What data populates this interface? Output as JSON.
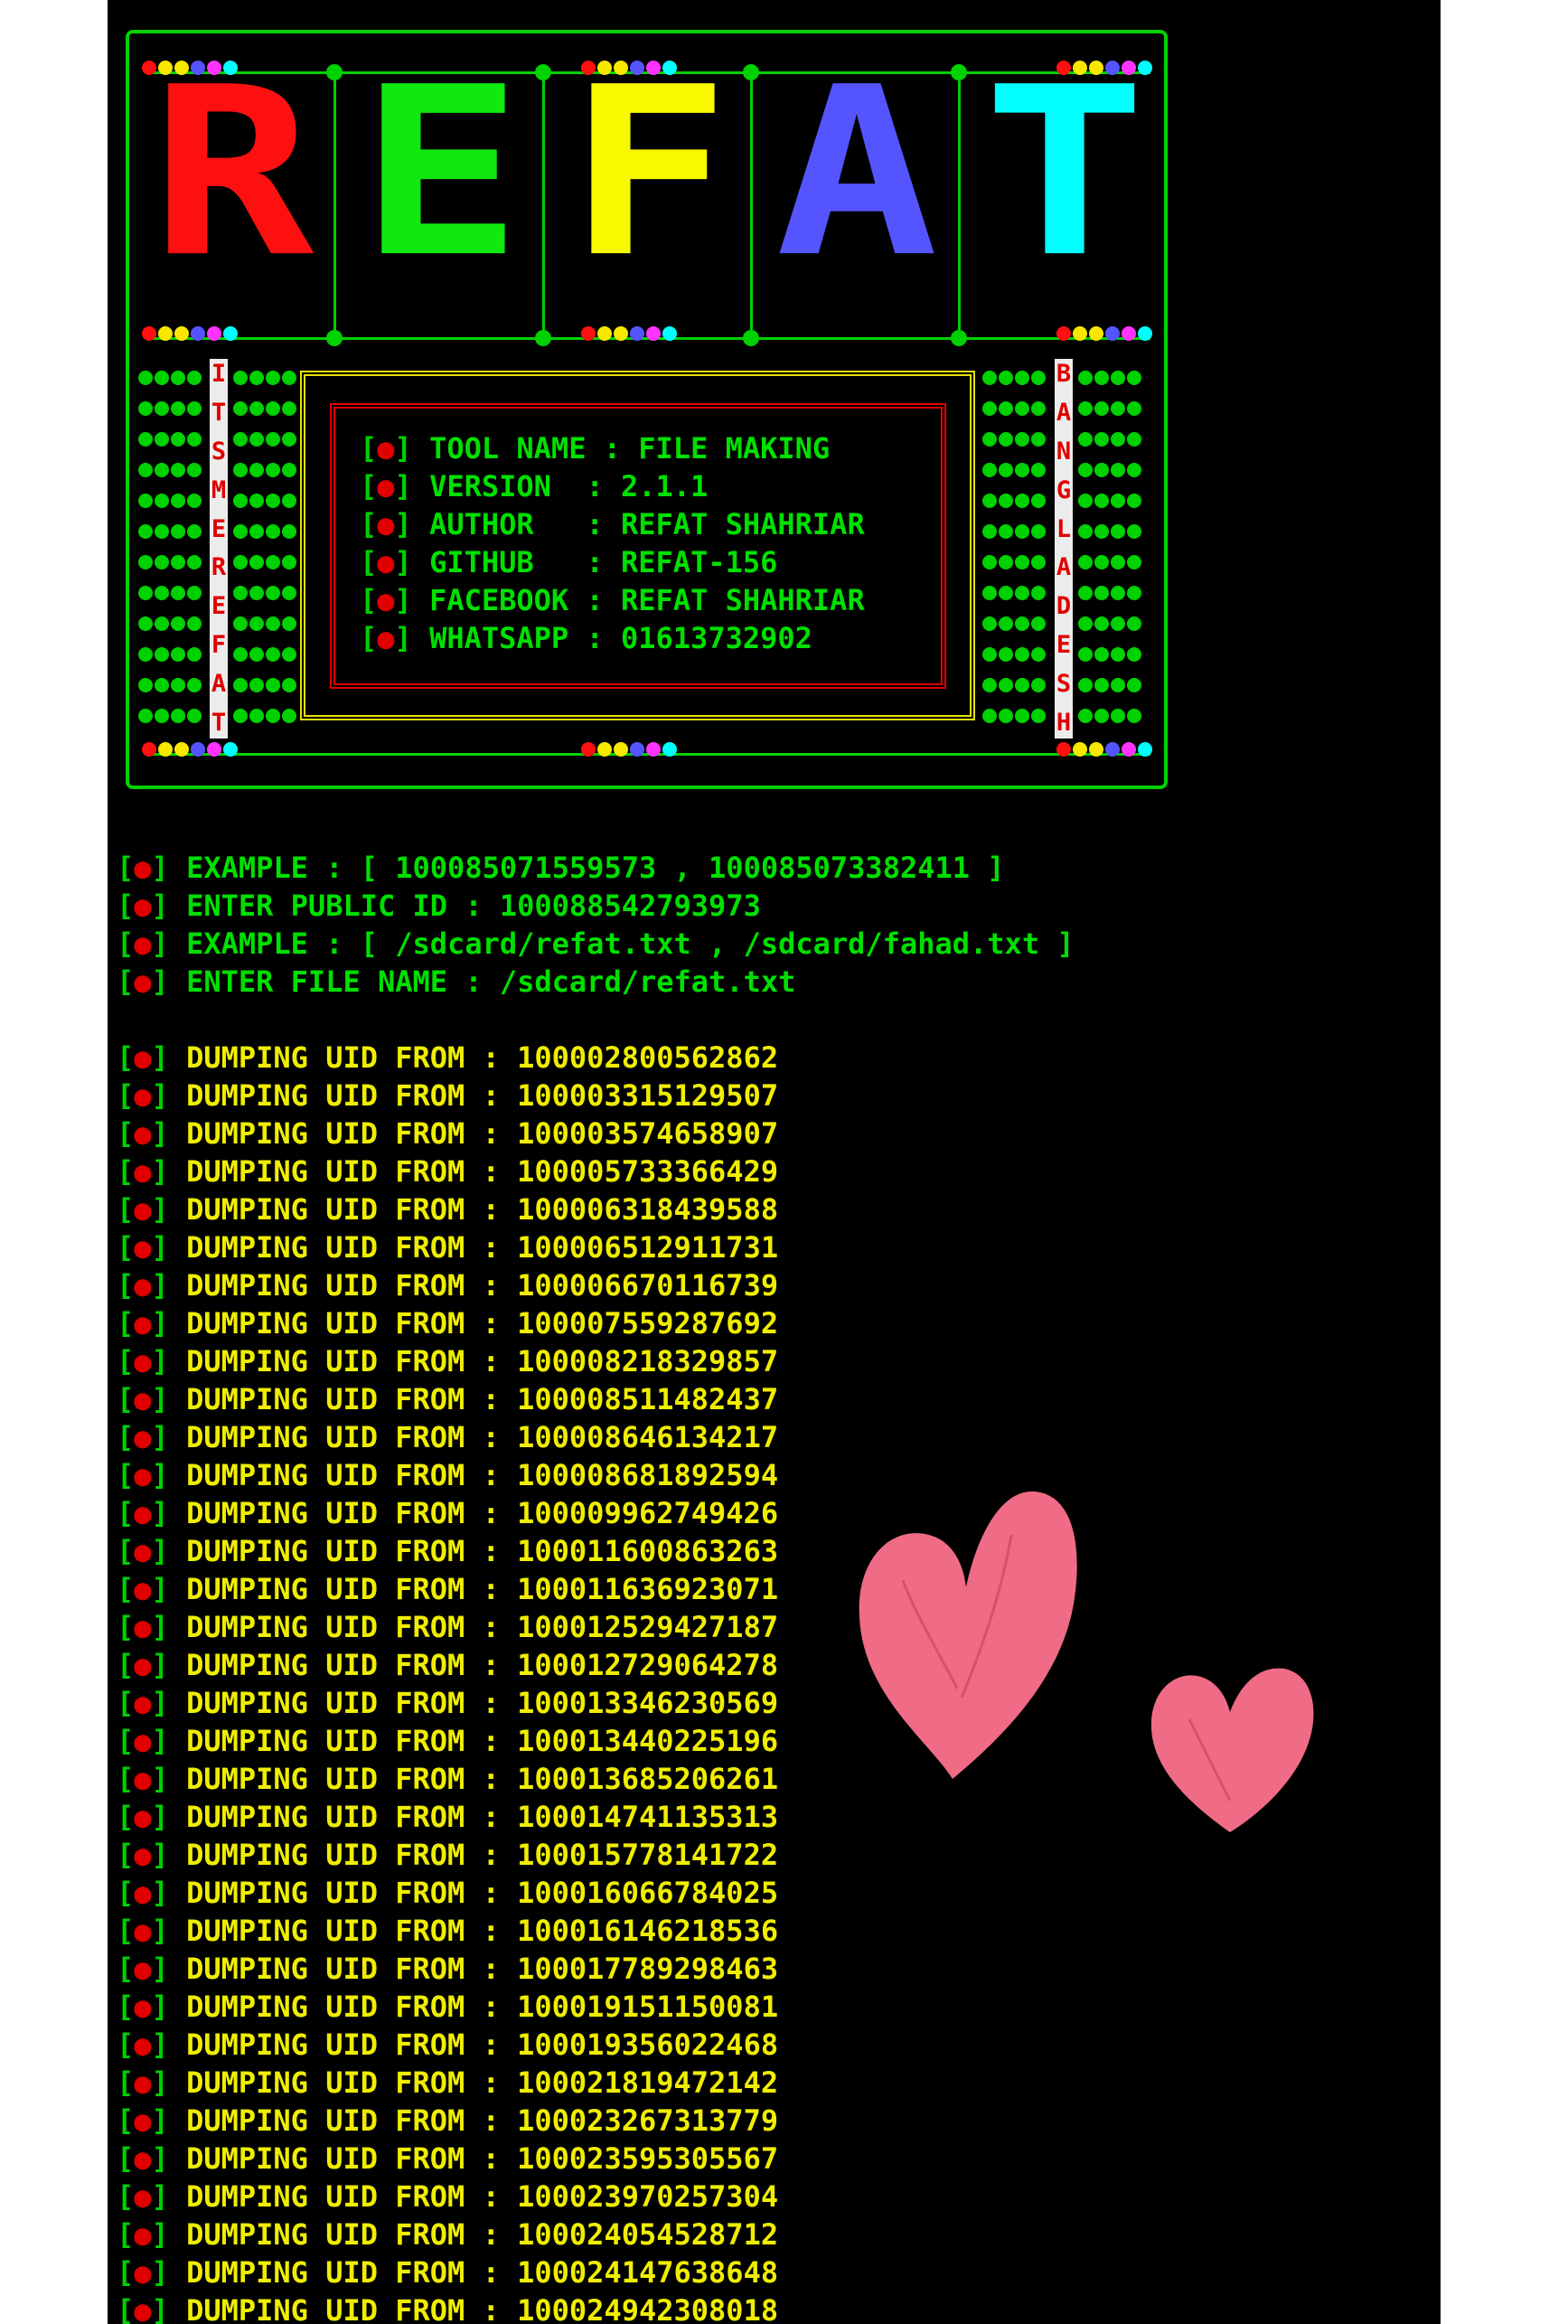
{
  "banner": {
    "letters": [
      {
        "char": "R",
        "color": "#ff1010"
      },
      {
        "char": "E",
        "color": "#10e810"
      },
      {
        "char": "F",
        "color": "#f8f800"
      },
      {
        "char": "A",
        "color": "#5555ff"
      },
      {
        "char": "T",
        "color": "#00ffff"
      }
    ],
    "left_vertical_text": [
      "I",
      "T",
      "S",
      "M",
      "E",
      "R",
      "E",
      "F",
      "A",
      "T"
    ],
    "right_vertical_text": [
      "B",
      "A",
      "N",
      "G",
      "L",
      "A",
      "D",
      "E",
      "S",
      "H"
    ]
  },
  "info": [
    {
      "label": "TOOL NAME",
      "value": "FILE MAKING"
    },
    {
      "label": "VERSION  ",
      "value": "2.1.1"
    },
    {
      "label": "AUTHOR   ",
      "value": "REFAT SHAHRIAR"
    },
    {
      "label": "GITHUB   ",
      "value": "REFAT-156"
    },
    {
      "label": "FACEBOOK ",
      "value": "REFAT SHAHRIAR"
    },
    {
      "label": "WHATSAPP ",
      "value": "01613732902"
    }
  ],
  "prompts": [
    "EXAMPLE : [ 100085071559573 , 100085073382411 ]",
    "ENTER PUBLIC ID : 100088542793973",
    "EXAMPLE : [ /sdcard/refat.txt , /sdcard/fahad.txt ]",
    "ENTER FILE NAME : /sdcard/refat.txt"
  ],
  "dump_label": "DUMPING UID FROM : ",
  "dump_uids": [
    "100002800562862",
    "100003315129507",
    "100003574658907",
    "100005733366429",
    "100006318439588",
    "100006512911731",
    "100006670116739",
    "100007559287692",
    "100008218329857",
    "100008511482437",
    "100008646134217",
    "100008681892594",
    "100009962749426",
    "100011600863263",
    "100011636923071",
    "100012529427187",
    "100012729064278",
    "100013346230569",
    "100013440225196",
    "100013685206261",
    "100014741135313",
    "100015778141722",
    "100016066784025",
    "100016146218536",
    "100017789298463",
    "100019151150081",
    "100019356022468",
    "100021819472142",
    "100023267313779",
    "100023595305567",
    "100023970257304",
    "100024054528712",
    "100024147638648",
    "100024942308018"
  ],
  "colors": {
    "terminal_bg": "#000000",
    "green": "#00e000",
    "yellow": "#f0ee00",
    "red": "#e00000",
    "heart": "#f06b85"
  }
}
